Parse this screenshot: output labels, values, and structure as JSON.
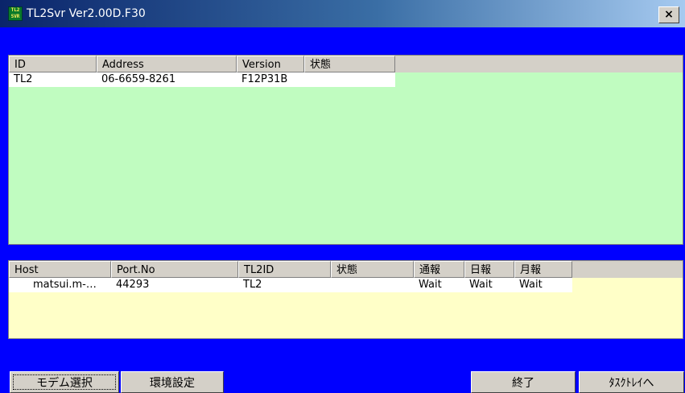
{
  "window": {
    "icon_text": "TL2 SVR",
    "title": "TL2Svr Ver2.00D.F30",
    "close_glyph": "×"
  },
  "devices": {
    "columns": [
      "ID",
      "Address",
      "Version",
      "状態"
    ],
    "rows": [
      {
        "id": "TL2",
        "address": "06-6659-8261",
        "version": "F12P31B",
        "status": ""
      }
    ],
    "background": "#c0fcc0"
  },
  "connections": {
    "columns": [
      "Host",
      "Port.No",
      "TL2ID",
      "状態",
      "通報",
      "日報",
      "月報"
    ],
    "rows": [
      {
        "host": "matsui.m-…",
        "port": "44293",
        "tl2id": "TL2",
        "status": "",
        "report": "Wait",
        "daily": "Wait",
        "monthly": "Wait"
      }
    ],
    "background": "#ffffc8"
  },
  "buttons": {
    "modem_select": "モデム選択",
    "env_settings": "環境設定",
    "exit": "終了",
    "tray": "ﾀｽｸﾄﾚｲへ"
  },
  "colors": {
    "frame": "#0000ff",
    "button_face": "#d4d0c8"
  }
}
